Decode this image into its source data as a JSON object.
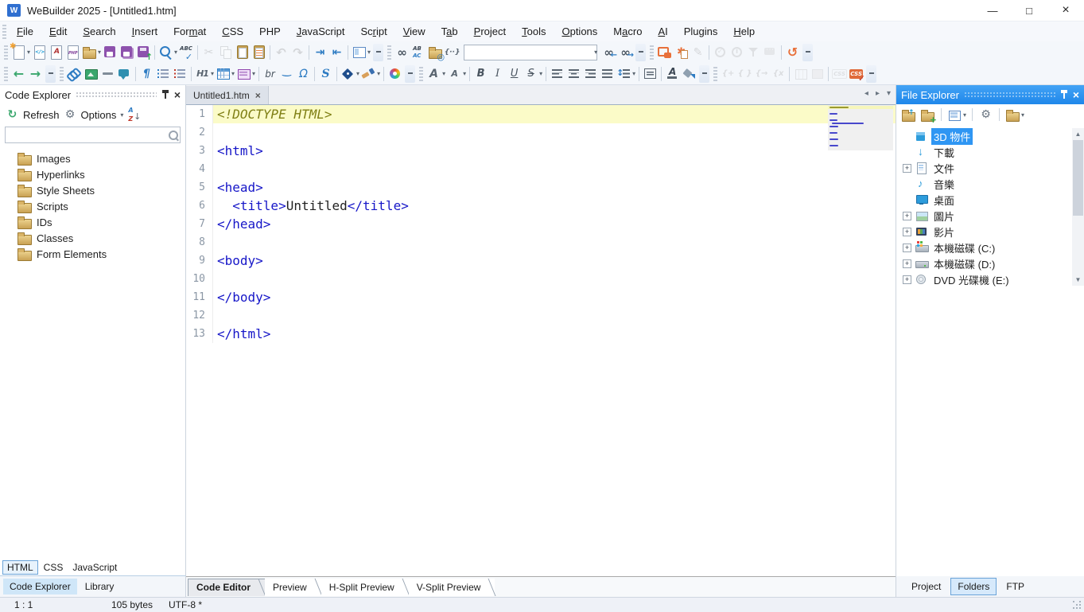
{
  "window": {
    "title": "WeBuilder 2025 - [Untitled1.htm]",
    "app_icon": "W",
    "controls": [
      {
        "name": "minimize",
        "glyph": "—"
      },
      {
        "name": "maximize",
        "glyph": "□"
      },
      {
        "name": "close",
        "glyph": "×"
      }
    ]
  },
  "menu": {
    "items": [
      {
        "label": "File",
        "u": 0
      },
      {
        "label": "Edit",
        "u": 0
      },
      {
        "label": "Search",
        "u": 0
      },
      {
        "label": "Insert",
        "u": 0
      },
      {
        "label": "Format",
        "u": 3
      },
      {
        "label": "CSS",
        "u": 0
      },
      {
        "label": "PHP",
        "u": -1
      },
      {
        "label": "JavaScript",
        "u": 0
      },
      {
        "label": "Script",
        "u": 2
      },
      {
        "label": "View",
        "u": 0
      },
      {
        "label": "Tab",
        "u": 1
      },
      {
        "label": "Project",
        "u": 0
      },
      {
        "label": "Tools",
        "u": 0
      },
      {
        "label": "Options",
        "u": 0
      },
      {
        "label": "Macro",
        "u": 1
      },
      {
        "label": "AI",
        "u": 0
      },
      {
        "label": "Plugins",
        "u": -1
      },
      {
        "label": "Help",
        "u": 0
      }
    ]
  },
  "toolbars": {
    "row1": [
      {
        "grip": true
      },
      {
        "icon": "new-file",
        "dd": true
      },
      {
        "icon": "new-html"
      },
      {
        "icon": "new-template"
      },
      {
        "icon": "new-php"
      },
      {
        "icon": "open-file",
        "fold": true,
        "dd": true
      },
      {
        "icon": "save"
      },
      {
        "icon": "save-all"
      },
      {
        "icon": "save-upload"
      },
      {
        "sep": true
      },
      {
        "icon": "search",
        "dd": true
      },
      {
        "icon": "spell-check"
      },
      {
        "sep": true
      },
      {
        "icon": "cut",
        "disabled": true
      },
      {
        "icon": "copy",
        "disabled": true
      },
      {
        "icon": "paste"
      },
      {
        "icon": "clipboard"
      },
      {
        "sep": true
      },
      {
        "icon": "undo",
        "disabled": true
      },
      {
        "icon": "redo",
        "disabled": true
      },
      {
        "sep": true
      },
      {
        "icon": "indent"
      },
      {
        "icon": "outdent"
      },
      {
        "sep": true
      },
      {
        "icon": "panel-view",
        "dd": true
      },
      {
        "overflow": true
      },
      {
        "grip": true
      },
      {
        "icon": "find"
      },
      {
        "icon": "replace"
      },
      {
        "icon": "find-in-files",
        "fold": true
      },
      {
        "icon": "regex"
      },
      {
        "combo": true
      },
      {
        "icon": "find-prev"
      },
      {
        "icon": "find-next"
      },
      {
        "overflow": true
      },
      {
        "grip": true
      },
      {
        "icon": "ai-chat"
      },
      {
        "icon": "ai-assist"
      },
      {
        "icon": "edit-pencil",
        "disabled": true
      },
      {
        "sep": true
      },
      {
        "icon": "validate",
        "disabled": true
      },
      {
        "icon": "info",
        "disabled": true
      },
      {
        "icon": "filter",
        "disabled": true
      },
      {
        "icon": "feedback",
        "disabled": true
      },
      {
        "sep": true
      },
      {
        "icon": "history"
      },
      {
        "overflow": true
      }
    ],
    "row2": [
      {
        "grip": true
      },
      {
        "icon": "back"
      },
      {
        "icon": "forward"
      },
      {
        "overflow": true
      },
      {
        "grip": true
      },
      {
        "icon": "link"
      },
      {
        "icon": "image"
      },
      {
        "icon": "horizontal-rule"
      },
      {
        "icon": "comment"
      },
      {
        "sep": true
      },
      {
        "icon": "paragraph"
      },
      {
        "icon": "bullet-list"
      },
      {
        "icon": "numbered-list"
      },
      {
        "sep": true
      },
      {
        "icon": "heading",
        "dd": true
      },
      {
        "icon": "table",
        "dd": true
      },
      {
        "icon": "form",
        "dd": true
      },
      {
        "sep": true
      },
      {
        "icon": "line-break"
      },
      {
        "icon": "nbsp"
      },
      {
        "icon": "special-char"
      },
      {
        "sep": true
      },
      {
        "icon": "span-scroll"
      },
      {
        "sep": true
      },
      {
        "icon": "tag",
        "dd": true
      },
      {
        "icon": "brush",
        "dd": true
      },
      {
        "sep": true
      },
      {
        "icon": "colors"
      },
      {
        "overflow": true
      },
      {
        "grip": true
      },
      {
        "icon": "font-name",
        "dd": true
      },
      {
        "icon": "font-size",
        "dd": true
      },
      {
        "sep": true
      },
      {
        "icon": "bold"
      },
      {
        "icon": "italic"
      },
      {
        "icon": "underline"
      },
      {
        "icon": "strikethrough",
        "dd": true
      },
      {
        "sep": true
      },
      {
        "icon": "align-left"
      },
      {
        "icon": "align-center"
      },
      {
        "icon": "align-right"
      },
      {
        "icon": "align-justify"
      },
      {
        "icon": "line-spacing",
        "dd": true
      },
      {
        "sep": true
      },
      {
        "icon": "div-box"
      },
      {
        "sep": true
      },
      {
        "icon": "font-color"
      },
      {
        "icon": "fill-color"
      },
      {
        "overflow": true
      },
      {
        "grip": true
      },
      {
        "icon": "brace-add",
        "disabled": true
      },
      {
        "icon": "braces",
        "disabled": true
      },
      {
        "icon": "brace-arrow",
        "disabled": true
      },
      {
        "icon": "brace-x",
        "disabled": true
      },
      {
        "sep": true
      },
      {
        "icon": "grid",
        "disabled": true
      },
      {
        "icon": "box",
        "disabled": true
      },
      {
        "sep": true
      },
      {
        "icon": "css-gray",
        "disabled": true
      },
      {
        "icon": "css-check"
      },
      {
        "overflow": true
      }
    ],
    "search_combo": {
      "value": "",
      "placeholder": ""
    },
    "extras": {
      "save-upload": "↑",
      "find-prev": "←",
      "find-next": "→",
      "spell-check": "✓",
      "css-check": "✓",
      "validate": "✓",
      "info": "i",
      "sort-az": "↓",
      "folder-up": "↑",
      "folder-new": "+",
      "find-in-files": "◎"
    }
  },
  "code_explorer": {
    "title": "Code Explorer",
    "refresh_label": "Refresh",
    "options_label": "Options",
    "search": {
      "value": "",
      "placeholder": ""
    },
    "items": [
      {
        "label": "Images"
      },
      {
        "label": "Hyperlinks"
      },
      {
        "label": "Style Sheets"
      },
      {
        "label": "Scripts"
      },
      {
        "label": "IDs"
      },
      {
        "label": "Classes"
      },
      {
        "label": "Form Elements"
      }
    ],
    "doc_tabs": [
      {
        "label": "HTML",
        "active": true
      },
      {
        "label": "CSS",
        "active": false
      },
      {
        "label": "JavaScript",
        "active": false
      }
    ],
    "panel_tabs": [
      {
        "label": "Code Explorer",
        "active": true
      },
      {
        "label": "Library",
        "active": false
      }
    ]
  },
  "editor": {
    "tabs": [
      {
        "label": "Untitled1.htm",
        "active": true,
        "close_glyph": "×"
      }
    ],
    "tab_scroll": [
      "◂",
      "▸",
      "▾"
    ],
    "lines": [
      {
        "n": "1",
        "hl": true,
        "tokens": [
          {
            "c": "doctype",
            "t": "<!DOCTYPE HTML>"
          }
        ]
      },
      {
        "n": "2",
        "tokens": []
      },
      {
        "n": "3",
        "tokens": [
          {
            "c": "tag",
            "t": "<html>"
          }
        ]
      },
      {
        "n": "4",
        "tokens": []
      },
      {
        "n": "5",
        "tokens": [
          {
            "c": "tag",
            "t": "<head>"
          }
        ]
      },
      {
        "n": "6",
        "tokens": [
          {
            "c": "plain",
            "t": "  "
          },
          {
            "c": "tag",
            "t": "<title>"
          },
          {
            "c": "plain",
            "t": "Untitled"
          },
          {
            "c": "tag",
            "t": "</title>"
          }
        ]
      },
      {
        "n": "7",
        "tokens": [
          {
            "c": "tag",
            "t": "</head>"
          }
        ]
      },
      {
        "n": "8",
        "tokens": []
      },
      {
        "n": "9",
        "tokens": [
          {
            "c": "tag",
            "t": "<body>"
          }
        ]
      },
      {
        "n": "10",
        "tokens": []
      },
      {
        "n": "11",
        "tokens": [
          {
            "c": "tag",
            "t": "</body>"
          }
        ]
      },
      {
        "n": "12",
        "tokens": []
      },
      {
        "n": "13",
        "tokens": [
          {
            "c": "tag",
            "t": "</html>"
          }
        ]
      }
    ],
    "view_tabs": [
      {
        "label": "Code Editor",
        "active": true
      },
      {
        "label": "Preview",
        "active": false
      },
      {
        "label": "H-Split Preview",
        "active": false
      },
      {
        "label": "V-Split Preview",
        "active": false
      }
    ]
  },
  "file_explorer": {
    "title": "File Explorer",
    "toolbar": [
      {
        "icon": "folder-up",
        "fold": true
      },
      {
        "icon": "folder-new",
        "fold": true
      },
      {
        "sep": true
      },
      {
        "icon": "view-mode",
        "dd": true
      },
      {
        "sep": true
      },
      {
        "icon": "gear"
      },
      {
        "sep": true
      },
      {
        "icon": "folder-menu",
        "fold": true,
        "dd": true
      }
    ],
    "items": [
      {
        "label": "3D 物件",
        "icon": "cube",
        "selected": true,
        "expandable": false
      },
      {
        "label": "下載",
        "icon": "download",
        "expandable": false
      },
      {
        "label": "文件",
        "icon": "document",
        "expandable": true
      },
      {
        "label": "音樂",
        "icon": "music",
        "expandable": false
      },
      {
        "label": "桌面",
        "icon": "desktop",
        "expandable": false
      },
      {
        "label": "圖片",
        "icon": "picture",
        "expandable": true
      },
      {
        "label": "影片",
        "icon": "video",
        "expandable": true
      },
      {
        "label": "本機磁碟 (C:)",
        "icon": "drive-win",
        "expandable": true
      },
      {
        "label": "本機磁碟 (D:)",
        "icon": "drive",
        "expandable": true
      },
      {
        "label": "DVD 光碟機 (E:)",
        "icon": "dvd",
        "expandable": true
      }
    ],
    "expand_glyph": "+",
    "scrollbar": {
      "up": "▲",
      "down": "▼"
    },
    "panel_tabs": [
      {
        "label": "Project",
        "active": false
      },
      {
        "label": "Folders",
        "active": true
      },
      {
        "label": "FTP",
        "active": false
      }
    ]
  },
  "statusbar": {
    "position": "1 : 1",
    "size": "105 bytes",
    "encoding": "UTF-8 *"
  },
  "colors": {
    "accent_blue": "#2f96f3",
    "line_highlight": "#fbfbc8",
    "tag_color": "#1616c8",
    "doctype_color": "#7f7f14"
  }
}
